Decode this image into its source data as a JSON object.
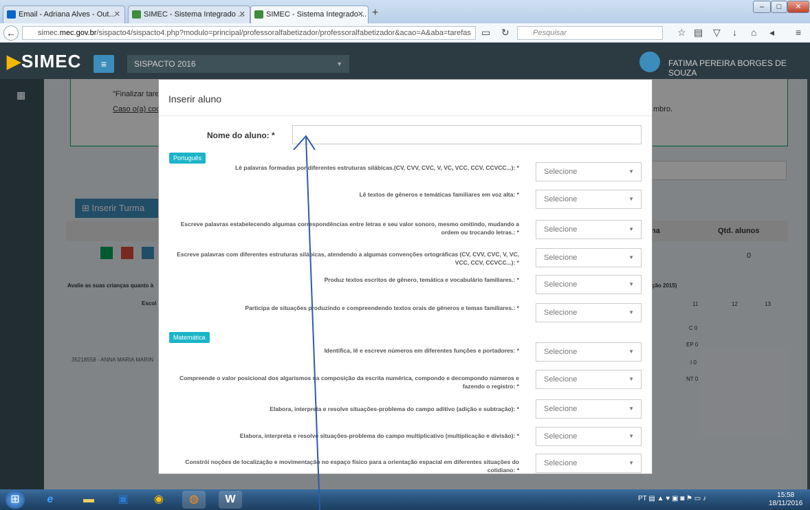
{
  "browser": {
    "tabs": [
      {
        "label": "Email - Adriana Alves - Out..."
      },
      {
        "label": "SIMEC - Sistema Integrado ..."
      },
      {
        "label": "SIMEC - Sistema Integrado ..."
      }
    ],
    "new_tab": "+",
    "url_prefix": "simec.",
    "url_domain": "mec.gov.br",
    "url_rest": "/sispacto4/sispacto4.php?modulo=principal/professoralfabetizador/professoralfabetizador&acao=A&aba=tarefas",
    "search_placeholder": "Pesquisar"
  },
  "app": {
    "logo": "SIMEC",
    "system": "SISPACTO 2016",
    "user": "FATIMA PEREIRA BORGES DE SOUZA"
  },
  "background": {
    "line1": "\"Finalizar tare",
    "line2": "Caso o(a) coo",
    "line2_end": "mbro.",
    "insert_class": "⊞ Inserir Turma",
    "col_students": "Qtd. alunos",
    "col_na": "na",
    "students_value": "0",
    "evaluate_text": "Avalie as suas crianças quanto à",
    "eval_end": "ção 2015)",
    "school_hdr": "Escol",
    "student_row": "35218558 - ANNA MARIA MARIN",
    "grade_cols": [
      "11",
      "12",
      "13"
    ],
    "grade_rows": [
      "C 0",
      "EP 0",
      "I 0",
      "NT 0"
    ]
  },
  "modal": {
    "title": "Inserir aluno",
    "name_label": "Nome do aluno: *",
    "name_value": "",
    "sections": [
      {
        "label": "Português"
      },
      {
        "label": "Matemática"
      }
    ],
    "select_placeholder": "Selecione",
    "portugues": [
      "Lê palavras formadas por diferentes estruturas silábicas.(CV, CVV, CVC, V, VC, VCC, CCV, CCVCC...): *",
      "Lê textos de gêneros e temáticas familiares em voz alta: *",
      "Escreve palavras estabelecendo algumas correspondências entre letras e seu valor sonoro, mesmo omitindo, mudando a ordem ou trocando letras.: *",
      "Escreve palavras com diferentes estruturas silábicas, atendendo a algumas convenções ortográficas (CV, CVV, CVC, V, VC, VCC, CCV, CCVCC...): *",
      "Produz textos escritos de gênero, temática e vocabulário familiares.: *",
      "Participa de situações produzindo e compreendendo textos orais de gêneros e temas familiares.: *"
    ],
    "matematica": [
      "Identifica, lê e escreve números em diferentes funções e portadores: *",
      "Compreende o valor posicional dos algarismos na composição da escrita numérica, compondo e decompondo números e fazendo o registro: *",
      "Elabora, interpreta e resolve situações-problema do campo aditivo (adição e subtração): *",
      "Elabora, interpreta e resolve situações-problema do campo multiplicativo (multiplicação e divisão): *",
      "Constrói noções de localização e movimentação no espaço físico para a orientação espacial em diferentes situações do cotidiano: *"
    ]
  },
  "taskbar": {
    "lang": "PT",
    "time": "15:58",
    "date": "18/11/2016"
  }
}
